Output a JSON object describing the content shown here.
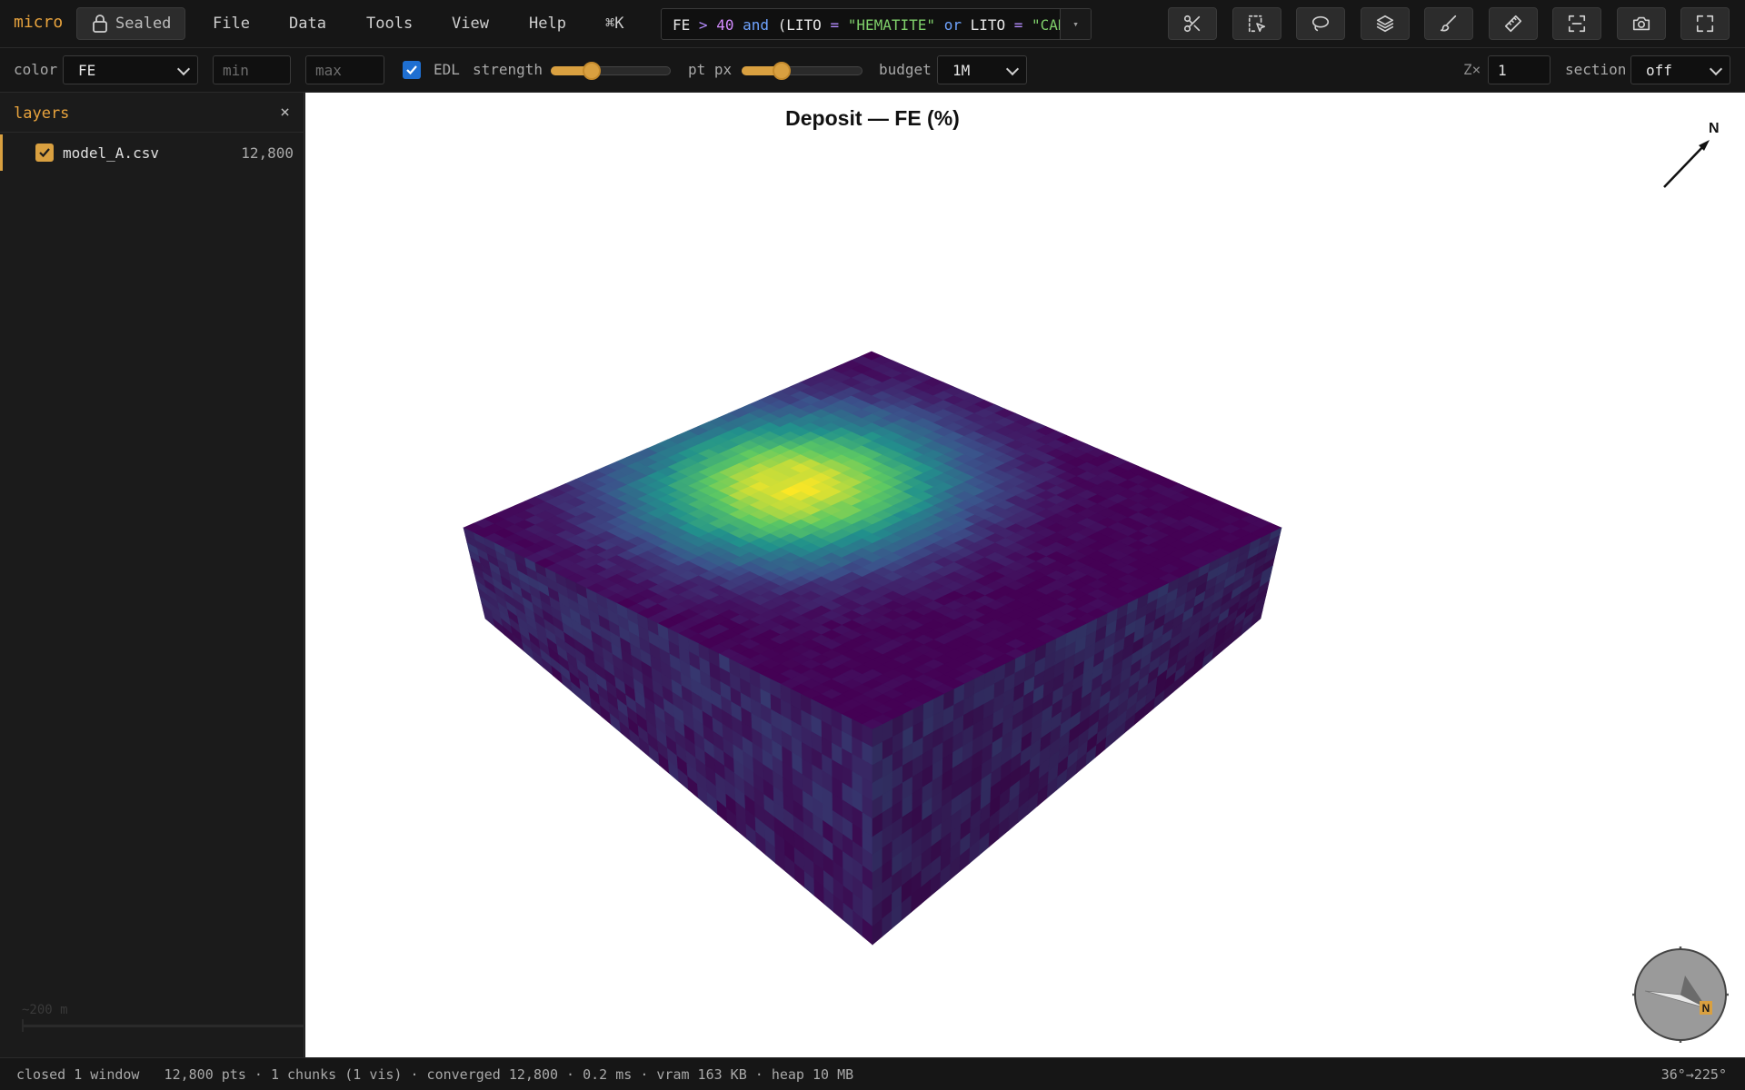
{
  "app": {
    "brand": "micro"
  },
  "topbar": {
    "sealed_label": "Sealed",
    "menu": [
      "File",
      "Data",
      "Tools",
      "View",
      "Help"
    ],
    "command_shortcut": "⌘K",
    "query": {
      "tokens": [
        {
          "t": "FE ",
          "c": ""
        },
        {
          "t": ">",
          "c": "op"
        },
        {
          "t": " ",
          "c": ""
        },
        {
          "t": "40",
          "c": "num"
        },
        {
          "t": " ",
          "c": ""
        },
        {
          "t": "and",
          "c": "kw"
        },
        {
          "t": " (LITO ",
          "c": ""
        },
        {
          "t": "=",
          "c": "op"
        },
        {
          "t": " ",
          "c": ""
        },
        {
          "t": "\"HEMATITE\"",
          "c": "str"
        },
        {
          "t": " ",
          "c": ""
        },
        {
          "t": "or",
          "c": "kw"
        },
        {
          "t": " LITO ",
          "c": ""
        },
        {
          "t": "=",
          "c": "op"
        },
        {
          "t": " ",
          "c": ""
        },
        {
          "t": "\"CANGA\")",
          "c": "str"
        }
      ],
      "dropdown_icon": "▾"
    },
    "tools": [
      "scissors-icon",
      "box-select-icon",
      "lasso-icon",
      "layers-icon",
      "brush-icon",
      "ruler-icon",
      "frame-icon",
      "camera-icon",
      "fullscreen-icon"
    ]
  },
  "toolbar": {
    "color_label": "color",
    "color_value": "FE",
    "min_placeholder": "min",
    "max_placeholder": "max",
    "edl_label": "EDL",
    "edl_checked": true,
    "strength_label": "strength",
    "strength_level": 0.34,
    "ptpx_label": "pt px",
    "ptpx_level": 0.33,
    "budget_label": "budget",
    "budget_value": "1M",
    "zx_label": "Z×",
    "zx_value": "1",
    "section_label": "section",
    "section_value": "off"
  },
  "sidebar": {
    "title": "layers",
    "close_icon": "×",
    "layer": {
      "name": "model_A.csv",
      "count": "12,800",
      "checked": true
    },
    "scale_label": "~200 m"
  },
  "viewport": {
    "title": "Deposit — FE (%)",
    "north_label": "N",
    "compass_label": "N",
    "colors": {
      "low": "#440154",
      "mid": "#21908d",
      "high": "#fde725"
    }
  },
  "status": {
    "left": "closed 1 window   12,800 pts · 1 chunks (1 vis) · converged 12,800 · 0.2 ms · vram 163 KB · heap 10 MB",
    "right": "36°→225°"
  }
}
